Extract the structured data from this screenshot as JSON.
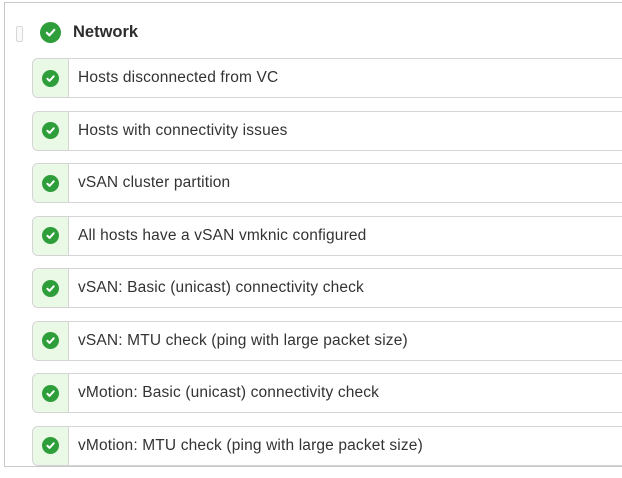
{
  "group": {
    "title": "Network",
    "status_icon": "check-circle-icon",
    "status_color": "#2e9e3a"
  },
  "checks": [
    {
      "label": "Hosts disconnected from VC",
      "status_icon": "check-circle-icon"
    },
    {
      "label": "Hosts with connectivity issues",
      "status_icon": "check-circle-icon"
    },
    {
      "label": "vSAN cluster partition",
      "status_icon": "check-circle-icon"
    },
    {
      "label": "All hosts have a vSAN vmknic configured",
      "status_icon": "check-circle-icon"
    },
    {
      "label": "vSAN: Basic (unicast) connectivity check",
      "status_icon": "check-circle-icon"
    },
    {
      "label": "vSAN: MTU check (ping with large packet size)",
      "status_icon": "check-circle-icon"
    },
    {
      "label": "vMotion: Basic (unicast) connectivity check",
      "status_icon": "check-circle-icon"
    },
    {
      "label": "vMotion: MTU check (ping with large packet size)",
      "status_icon": "check-circle-icon"
    }
  ],
  "colors": {
    "success": "#2e9e3a",
    "row_lead_bg": "#eaf8e6",
    "border": "#d4d4d4"
  }
}
